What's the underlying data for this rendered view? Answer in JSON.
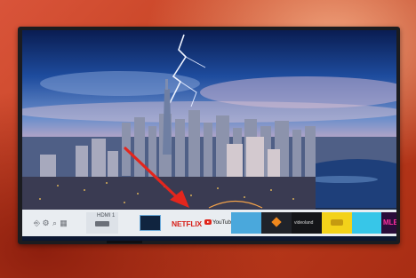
{
  "smart_hub": {
    "system_icons": [
      "source-icon",
      "settings-icon",
      "search-icon",
      "apps-grid-icon"
    ],
    "apps": [
      {
        "name": "source-hdmi-tile",
        "label": "HDMI 1"
      },
      {
        "name": "smart-tv-tile",
        "label": ""
      },
      {
        "name": "netflix-tile",
        "label": "NETFLIX"
      },
      {
        "name": "youtube-tile",
        "label": "YouTube"
      },
      {
        "name": "blue-app-tile",
        "label": ""
      },
      {
        "name": "orange-app-tile",
        "label": ""
      },
      {
        "name": "videoland-tile",
        "label": "videoland"
      },
      {
        "name": "yellow-app-tile",
        "label": ""
      },
      {
        "name": "cyan-app-tile",
        "label": ""
      },
      {
        "name": "mlb-tile",
        "label": "MLB"
      }
    ]
  },
  "colors": {
    "accent_arrow": "#e3261d",
    "bar_background": "#e9edf1",
    "netflix_red": "#d7221c"
  }
}
